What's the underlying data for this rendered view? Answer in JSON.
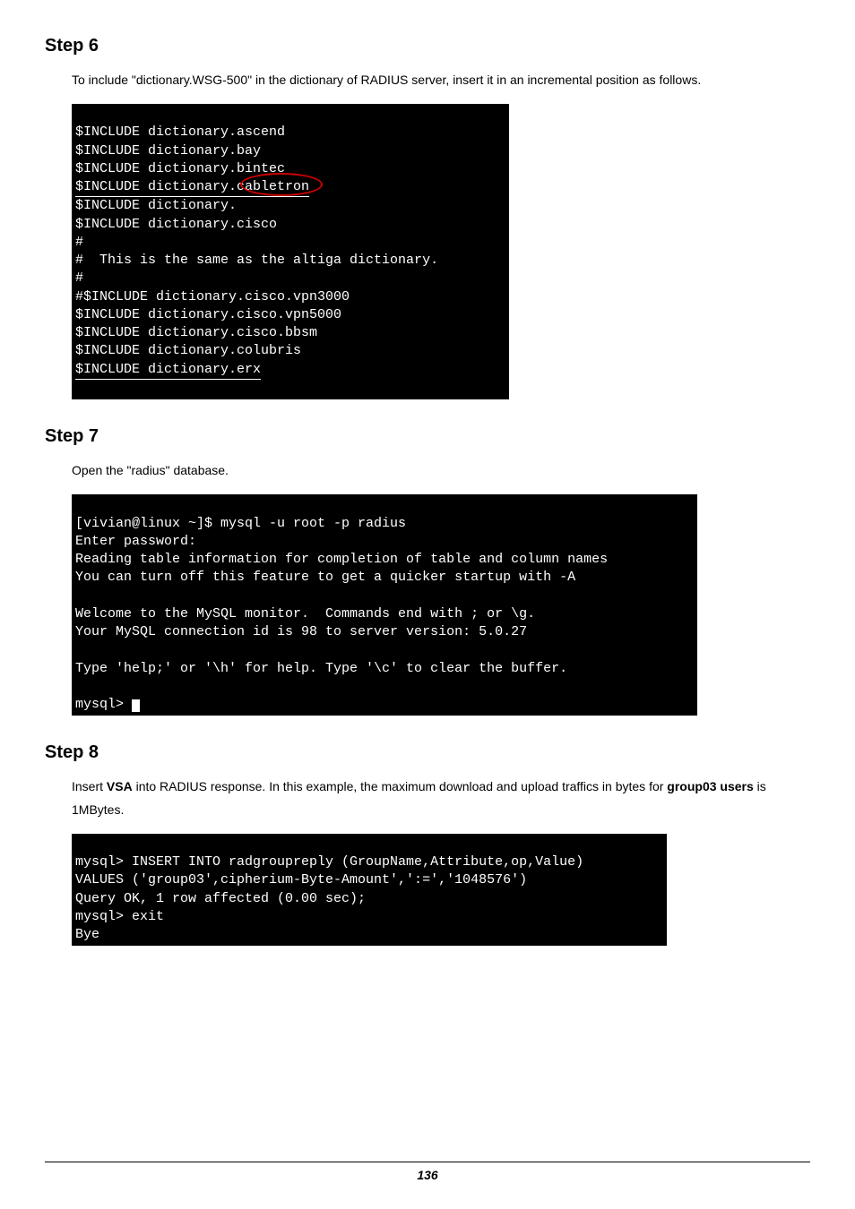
{
  "step6": {
    "heading": "Step 6",
    "paragraph": "To include \"dictionary.WSG-500\" in the dictionary of RADIUS server, insert it in an incremental position as follows.",
    "terminal_lines": [
      "$INCLUDE dictionary.ascend",
      "$INCLUDE dictionary.bay",
      "$INCLUDE dictionary.bintec",
      "$INCLUDE dictionary.cabletron",
      "$INCLUDE dictionary.",
      "$INCLUDE dictionary.cisco",
      "#",
      "#  This is the same as the altiga dictionary.",
      "#",
      "#$INCLUDE dictionary.cisco.vpn3000",
      "$INCLUDE dictionary.cisco.vpn5000",
      "$INCLUDE dictionary.cisco.bbsm",
      "$INCLUDE dictionary.colubris",
      "$INCLUDE dictionary.erx"
    ]
  },
  "step7": {
    "heading": "Step 7",
    "paragraph": "Open the \"radius\" database.",
    "terminal_lines": [
      "[vivian@linux ~]$ mysql -u root -p radius",
      "Enter password:",
      "Reading table information for completion of table and column names",
      "You can turn off this feature to get a quicker startup with -A",
      "",
      "Welcome to the MySQL monitor.  Commands end with ; or \\g.",
      "Your MySQL connection id is 98 to server version: 5.0.27",
      "",
      "Type 'help;' or '\\h' for help. Type '\\c' to clear the buffer.",
      "",
      "mysql> "
    ]
  },
  "step8": {
    "heading": "Step 8",
    "para_pre": "Insert ",
    "para_bold1": "VSA",
    "para_mid": " into RADIUS response. In this example, the maximum download and upload traffics in bytes for ",
    "para_bold2": "group03 users",
    "para_post": " is 1MBytes.",
    "terminal_lines": [
      "mysql> INSERT INTO radgroupreply (GroupName,Attribute,op,Value)",
      "VALUES ('group03',cipherium-Byte-Amount',':=','1048576')",
      "Query OK, 1 row affected (0.00 sec);",
      "mysql> exit",
      "Bye"
    ]
  },
  "page_number": "136"
}
